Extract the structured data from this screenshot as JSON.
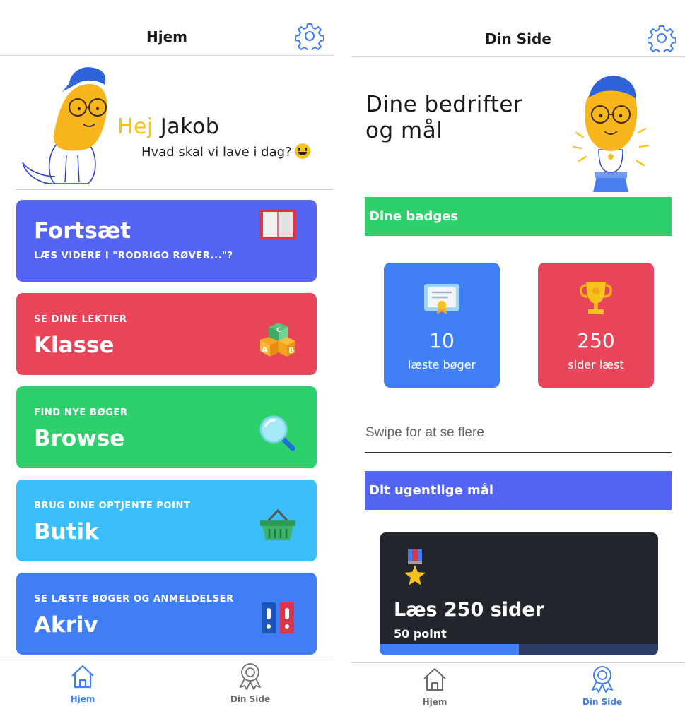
{
  "left_screen": {
    "header": {
      "title": "Hjem"
    },
    "greeting": {
      "hej": "Hej",
      "name": "Jakob",
      "subtitle": "Hvad skal vi lave i dag?"
    },
    "cards": [
      {
        "subtitle": "LÆS VIDERE I \"RODRIGO RØVER...\"?",
        "title": "Fortsæt",
        "color": "#5464f5",
        "icon": "book-icon"
      },
      {
        "subtitle": "SE DINE LEKTIER",
        "title": "Klasse",
        "color": "#e8455a",
        "icon": "abc-blocks-icon"
      },
      {
        "subtitle": "FIND NYE BØGER",
        "title": "Browse",
        "color": "#2ed06c",
        "icon": "magnifier-icon"
      },
      {
        "subtitle": "BRUG DINE OPTJENTE POINT",
        "title": "Butik",
        "color": "#3bbdf7",
        "icon": "basket-icon"
      },
      {
        "subtitle": "SE LÆSTE BØGER OG ANMELDELSER",
        "title": "Akriv",
        "color": "#3f7ef5",
        "icon": "binders-icon"
      }
    ],
    "tabs": [
      {
        "label": "Hjem",
        "icon": "home-icon",
        "active": true
      },
      {
        "label": "Din Side",
        "icon": "award-icon",
        "active": false
      }
    ]
  },
  "right_screen": {
    "header": {
      "title": "Din Side"
    },
    "title_line1": "Dine bedrifter",
    "title_line2": "og mål",
    "badges_section": {
      "label": "Dine badges",
      "color": "#2ed06c"
    },
    "badges": [
      {
        "value": "10",
        "label": "læste bøger",
        "color": "#3f7ef5",
        "icon": "certificate-icon"
      },
      {
        "value": "250",
        "label": "sider læst",
        "color": "#e8455a",
        "icon": "trophy-icon"
      }
    ],
    "swipe_hint": "Swipe for at se flere",
    "goal_section": {
      "label": "Dit ugentlige mål",
      "color": "#5464f5"
    },
    "goal": {
      "title": "Læs 250 sider",
      "points": "50 point",
      "progress": 0.5,
      "icon": "medal-icon"
    },
    "tabs": [
      {
        "label": "Hjem",
        "icon": "home-icon",
        "active": false
      },
      {
        "label": "Din Side",
        "icon": "award-icon",
        "active": true
      }
    ]
  },
  "colors": {
    "accent": "#3f7ef5",
    "tab_inactive": "#6b6b6b",
    "greeting_yellow": "#f7c21b"
  }
}
